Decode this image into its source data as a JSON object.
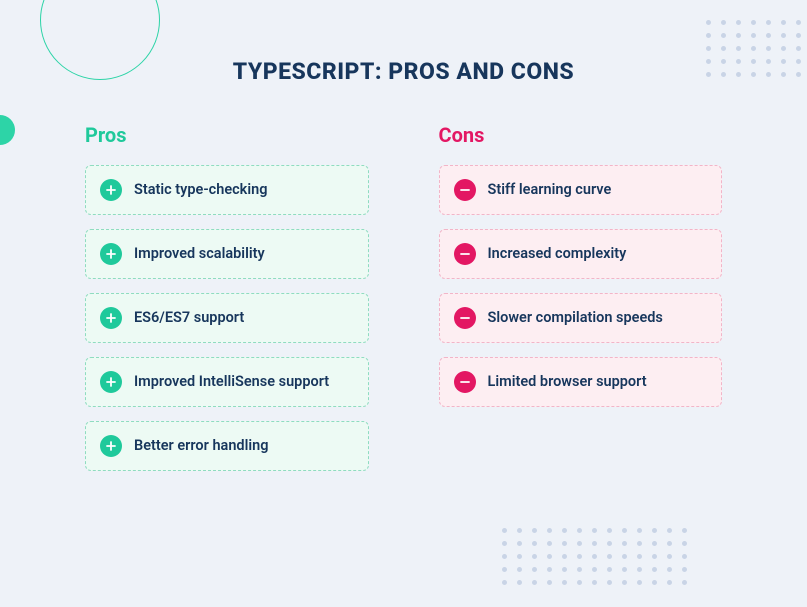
{
  "title": "TYPESCRIPT: PROS AND CONS",
  "pros": {
    "heading": "Pros",
    "items": [
      "Static type-checking",
      "Improved scalability",
      "ES6/ES7 support",
      "Improved IntelliSense support",
      "Better error handling"
    ]
  },
  "cons": {
    "heading": "Cons",
    "items": [
      "Stiff learning curve",
      "Increased complexity",
      "Slower compilation speeds",
      "Limited browser support"
    ]
  }
}
